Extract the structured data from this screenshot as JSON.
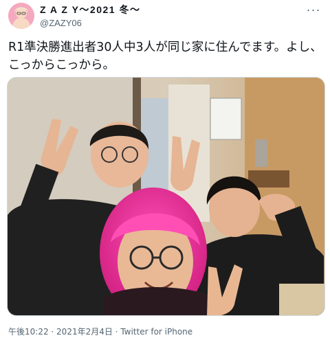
{
  "user": {
    "display_name": "Z A Z Y～2021 冬～",
    "handle": "@ZAZY06",
    "avatar_icon": "avatar-photo"
  },
  "more_icon": "more-dots-icon",
  "more_glyph": "···",
  "tweet": {
    "text": "R1準決勝進出者30人中3人が同じ家に住んでます。よし、こっからこっから。"
  },
  "photo": {
    "icon": "group-selfie-photo"
  },
  "meta": {
    "time": "午後10:22",
    "separator": " · ",
    "date": "2021年2月4日",
    "source": "Twitter for iPhone"
  },
  "colors": {
    "text": "#0f1419",
    "secondary": "#536471",
    "border": "#cfd9de"
  }
}
